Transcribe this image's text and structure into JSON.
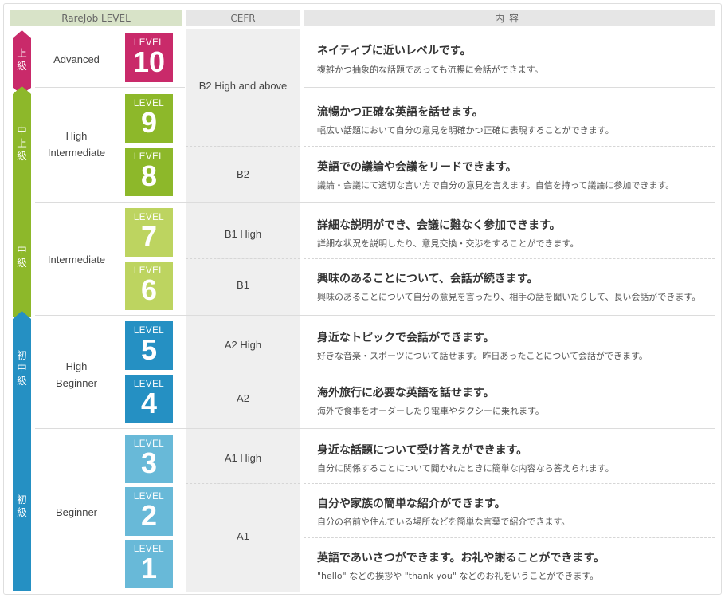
{
  "header": {
    "level_col": "RareJob LEVEL",
    "cefr_col": "CEFR",
    "content_col": "内容"
  },
  "colors": {
    "upper": "#c92a6a",
    "upper_intermediate": "#8db82a",
    "intermediate": "#bdd460",
    "beginner_intermediate": "#2590c3",
    "beginner": "#68b9d8"
  },
  "tiers": [
    {
      "label": "上級",
      "color": "#c92a6a"
    },
    {
      "label": "中上級",
      "color": "#8db82a"
    },
    {
      "label": "中級",
      "color": "#8db82a"
    },
    {
      "label": "初中級",
      "color": "#2590c3"
    },
    {
      "label": "初級",
      "color": "#2590c3"
    }
  ],
  "groups": [
    "Advanced",
    "High Intermediate",
    "Intermediate",
    "High Beginner",
    "Beginner"
  ],
  "levels": [
    {
      "lv": "LEVEL",
      "num": "10",
      "color": "#c92a6a",
      "title": "ネイティブに近いレベルです。",
      "desc": "複雑かつ抽象的な話題であっても流暢に会話ができます。"
    },
    {
      "lv": "LEVEL",
      "num": "9",
      "color": "#8db82a",
      "title": "流暢かつ正確な英語を話せます。",
      "desc": "幅広い話題において自分の意見を明確かつ正確に表現することができます。"
    },
    {
      "lv": "LEVEL",
      "num": "8",
      "color": "#8db82a",
      "title": "英語での議論や会議をリードできます。",
      "desc": "議論・会議にて適切な言い方で自分の意見を言えます。自信を持って議論に参加できます。"
    },
    {
      "lv": "LEVEL",
      "num": "7",
      "color": "#bdd460",
      "title": "詳細な説明ができ、会議に難なく参加できます。",
      "desc": "詳細な状況を説明したり、意見交換・交渉をすることができます。"
    },
    {
      "lv": "LEVEL",
      "num": "6",
      "color": "#bdd460",
      "title": "興味のあることについて、会話が続きます。",
      "desc": "興味のあることについて自分の意見を言ったり、相手の話を聞いたりして、長い会話ができます。"
    },
    {
      "lv": "LEVEL",
      "num": "5",
      "color": "#2590c3",
      "title": "身近なトピックで会話ができます。",
      "desc": "好きな音楽・スポーツについて話せます。昨日あったことについて会話ができます。"
    },
    {
      "lv": "LEVEL",
      "num": "4",
      "color": "#2590c3",
      "title": "海外旅行に必要な英語を話せます。",
      "desc": "海外で食事をオーダーしたり電車やタクシーに乗れます。"
    },
    {
      "lv": "LEVEL",
      "num": "3",
      "color": "#68b9d8",
      "title": "身近な話題について受け答えができます。",
      "desc": "自分に関係することについて聞かれたときに簡単な内容なら答えられます。"
    },
    {
      "lv": "LEVEL",
      "num": "2",
      "color": "#68b9d8",
      "title": "自分や家族の簡単な紹介ができます。",
      "desc": "自分の名前や住んでいる場所などを簡単な言葉で紹介できます。"
    },
    {
      "lv": "LEVEL",
      "num": "1",
      "color": "#68b9d8",
      "title": "英語であいさつができます。お礼や謝ることができます。",
      "desc": "\"hello\" などの挨拶や \"thank you\" などのお礼をいうことができます。"
    }
  ],
  "cefr": [
    "B2 High and above",
    "B2",
    "B1 High",
    "B1",
    "A2 High",
    "A2",
    "A1 High",
    "A1"
  ]
}
